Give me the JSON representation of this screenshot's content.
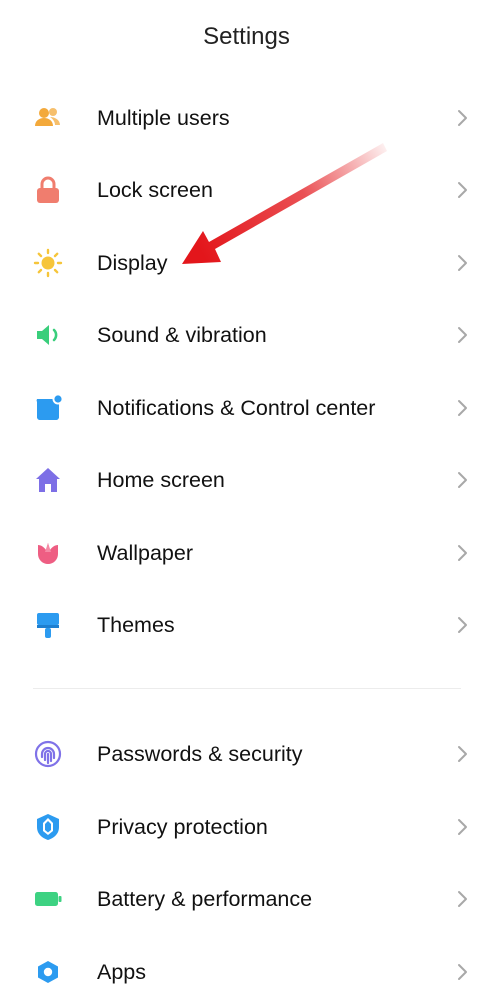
{
  "header": {
    "title": "Settings"
  },
  "colors": {
    "multiple_users": "#F3A93B",
    "lock_screen": "#F07D6E",
    "display": "#F6C53A",
    "sound": "#39CE7B",
    "notifications": "#2C9BF0",
    "home_screen": "#7D6FE6",
    "wallpaper": "#EE5E83",
    "themes": "#2C9BF0",
    "passwords": "#7F72E8",
    "privacy": "#2C9BF0",
    "battery": "#3DD282",
    "apps": "#2C9BF0",
    "chevron": "#a8a8a8",
    "annotation_arrow": "#E3161B"
  },
  "groups": [
    {
      "items": [
        {
          "label": "Multiple users",
          "icon": "users-icon"
        },
        {
          "label": "Lock screen",
          "icon": "lock-icon"
        },
        {
          "label": "Display",
          "icon": "sun-icon"
        },
        {
          "label": "Sound & vibration",
          "icon": "speaker-icon"
        },
        {
          "label": "Notifications & Control center",
          "icon": "notification-icon"
        },
        {
          "label": "Home screen",
          "icon": "home-icon"
        },
        {
          "label": "Wallpaper",
          "icon": "tulip-icon"
        },
        {
          "label": "Themes",
          "icon": "brush-icon"
        }
      ]
    },
    {
      "items": [
        {
          "label": "Passwords & security",
          "icon": "fingerprint-icon"
        },
        {
          "label": "Privacy protection",
          "icon": "shield-icon"
        },
        {
          "label": "Battery & performance",
          "icon": "battery-icon"
        },
        {
          "label": "Apps",
          "icon": "gear-icon"
        }
      ]
    }
  ]
}
